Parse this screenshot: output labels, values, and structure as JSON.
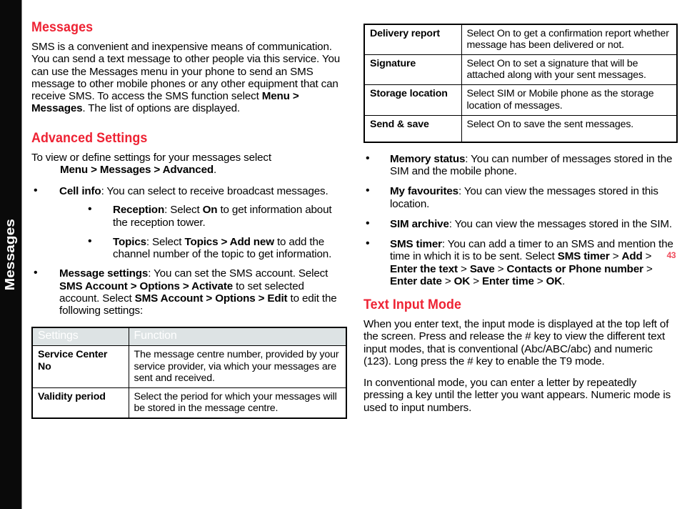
{
  "side_tab": {
    "label": "Messages"
  },
  "page_number": "43",
  "left_column": {
    "heading_messages": "Messages",
    "intro_paragraph": {
      "part1": "SMS is a convenient and inexpensive means of communication. You can send a text message to other people via this service. You can use the Messages menu in your phone to send an SMS message to other mobile phones or any other equipment that can receive SMS. To access the SMS function select ",
      "bold1": "Menu > Messages",
      "part2": ". The list of options are displayed."
    },
    "heading_advanced": "Advanced Settings",
    "advanced_intro": {
      "part1": "To view or define settings for your messages select",
      "bold1": "Menu > Messages > Advanced",
      "part2": "."
    },
    "bullets": [
      {
        "bold": "Cell info",
        "text": ": You can select to receive broadcast messages.",
        "sub": [
          {
            "bold": "Reception",
            "text_a": ": Select ",
            "bold_b": "On",
            "text_b": " to get information about the reception tower."
          },
          {
            "bold": "Topics",
            "text_a": ":  Select ",
            "bold_b": "Topics > Add new",
            "text_b": " to add the channel number of the topic to get information."
          }
        ]
      },
      {
        "bold": "Message settings",
        "text_a": ": You can set the SMS account. Select ",
        "bold_b": "SMS Account > Options > Activate",
        "text_b": " to set selected account. Select ",
        "bold_c": "SMS Account > Options > Edit",
        "text_c": " to edit the following settings:"
      }
    ],
    "table": {
      "headers": [
        "Settings",
        "Function"
      ],
      "rows": [
        {
          "setting": "Service Center No",
          "function": "The message centre number, provided by your service provider, via which your messages are sent and received."
        },
        {
          "setting": "Validity period",
          "function": "Select the period for which your messages will be stored in the message centre."
        }
      ]
    }
  },
  "right_column": {
    "table": {
      "rows": [
        {
          "setting": "Delivery report",
          "function": "Select On to get a confirmation report whether message has been delivered or not."
        },
        {
          "setting": "Signature",
          "function": "Select On to set a signature that will be attached along with your sent messages."
        },
        {
          "setting": "Storage location",
          "function": "Select SIM or Mobile phone as the storage location of messages."
        },
        {
          "setting": "Send & save",
          "function": "Select On to save the sent messages."
        }
      ]
    },
    "bullets": [
      {
        "bold": "Memory status",
        "text": ": You can number of messages stored in the SIM and the mobile phone."
      },
      {
        "bold": "My favourites",
        "text": ": You can view the messages stored in this location."
      },
      {
        "bold": "SIM archive",
        "text": ": You can view the messages stored in the SIM."
      },
      {
        "bold": "SMS timer",
        "text_a": ": You can add a timer to an SMS and mention the time in which it is to be sent. Select ",
        "bold_b": "SMS timer",
        "sep1": " > ",
        "bold_c": "Add",
        "sep2": " > ",
        "bold_d": "Enter the text",
        "sep3": " > ",
        "bold_e": "Save",
        "sep4": " > ",
        "bold_f": "Contacts or Phone number",
        "sep5": " > ",
        "bold_g": "Enter date",
        "sep6": " > ",
        "bold_h": "OK",
        "sep7": " > ",
        "bold_i": "Enter time",
        "sep8": " > ",
        "bold_j": "OK",
        "text_end": "."
      }
    ],
    "heading_text_input": "Text Input Mode",
    "paragraph1": "When you enter text, the input mode is displayed at the top left of the screen. Press and release the # key to view the different text input modes, that is conventional (Abc/ABC/abc) and numeric (123). Long press the # key to enable the T9 mode.",
    "paragraph2": "In conventional mode, you can enter a letter by repeatedly pressing a key until the letter you want appears. Numeric mode is used to input numbers."
  }
}
